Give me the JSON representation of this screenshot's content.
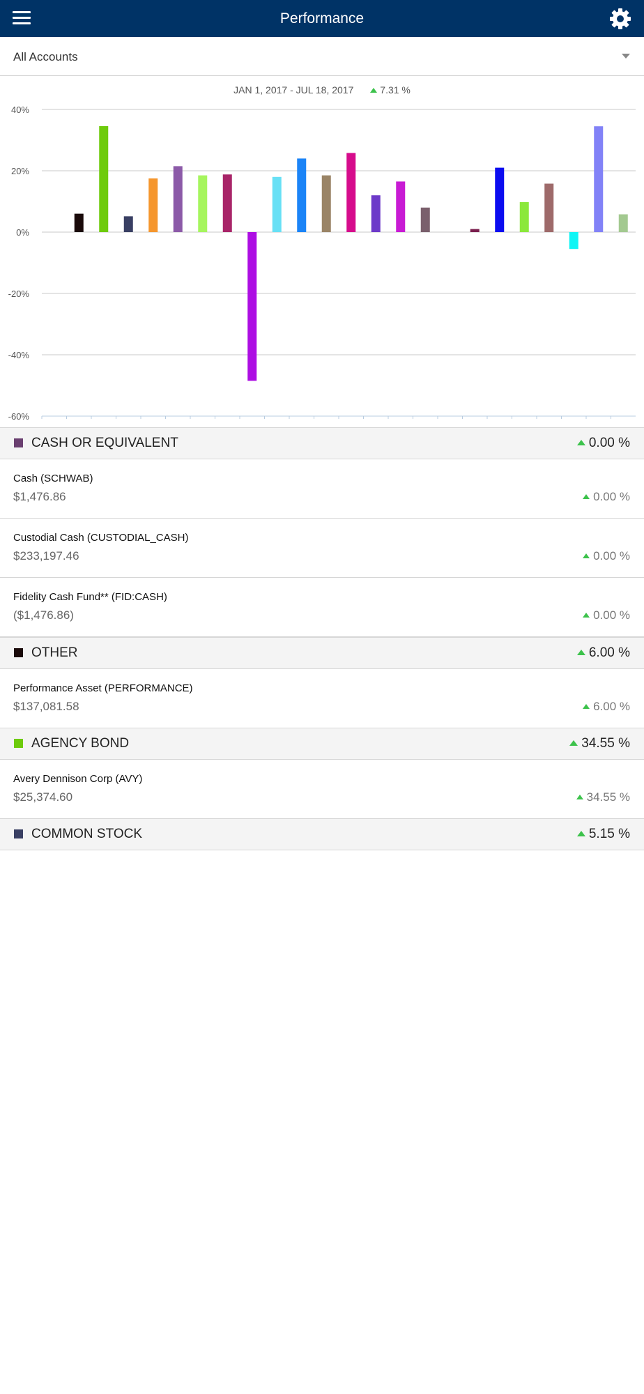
{
  "header": {
    "title": "Performance",
    "menu_icon": "hamburger-menu-icon",
    "settings_icon": "gear-icon"
  },
  "account_selector": {
    "selected": "All Accounts"
  },
  "chart_header": {
    "date_range": "JAN 1, 2017 - JUL 18, 2017",
    "total_return": "7.31 %"
  },
  "chart_data": {
    "type": "bar",
    "ylim": [
      -60,
      40
    ],
    "yticks": [
      40,
      20,
      0,
      -20,
      -40,
      -60
    ],
    "ytick_labels": [
      "40%",
      "20%",
      "0%",
      "-20%",
      "-40%",
      "-60%"
    ],
    "grid": true,
    "values": [
      0,
      6.0,
      34.55,
      5.15,
      17.5,
      21.5,
      18.5,
      18.8,
      -48.5,
      18.0,
      24.0,
      18.5,
      25.8,
      12.0,
      16.5,
      8.0,
      0,
      1.0,
      21.0,
      9.8,
      15.8,
      -5.5,
      34.5,
      5.8
    ],
    "colors": [
      "#ffffff",
      "#1a0a0a",
      "#6ecb0c",
      "#393f63",
      "#f5962d",
      "#8c5aa8",
      "#a6f55e",
      "#a82468",
      "#ad0ee3",
      "#68e0f5",
      "#1b84f7",
      "#9a8466",
      "#d60c8c",
      "#6d3ac9",
      "#c81bd4",
      "#7a5f6c",
      "#ffffff",
      "#7a1f4e",
      "#0b0cf0",
      "#8be83b",
      "#9e6a6a",
      "#11f5f5",
      "#8282f7",
      "#a3c990"
    ]
  },
  "sections": [
    {
      "name": "CASH OR EQUIVALENT",
      "pct": "0.00 %",
      "color": "#6a3f70"
    },
    {
      "name": "OTHER",
      "pct": "6.00 %",
      "color": "#1a0a0a"
    },
    {
      "name": "AGENCY BOND",
      "pct": "34.55 %",
      "color": "#6ecb0c"
    },
    {
      "name": "COMMON STOCK",
      "pct": "5.15 %",
      "color": "#393f63"
    }
  ],
  "holdings": [
    {
      "name": "Cash (SCHWAB)",
      "value": "$1,476.86",
      "pct": "0.00 %"
    },
    {
      "name": "Custodial Cash (CUSTODIAL_CASH)",
      "value": "$233,197.46",
      "pct": "0.00 %"
    },
    {
      "name": "Fidelity Cash Fund** (FID:CASH)",
      "value": "($1,476.86)",
      "pct": "0.00 %"
    },
    {
      "name": "Performance Asset (PERFORMANCE)",
      "value": "$137,081.58",
      "pct": "6.00 %"
    },
    {
      "name": "Avery Dennison Corp (AVY)",
      "value": "$25,374.60",
      "pct": "34.55 %"
    }
  ]
}
